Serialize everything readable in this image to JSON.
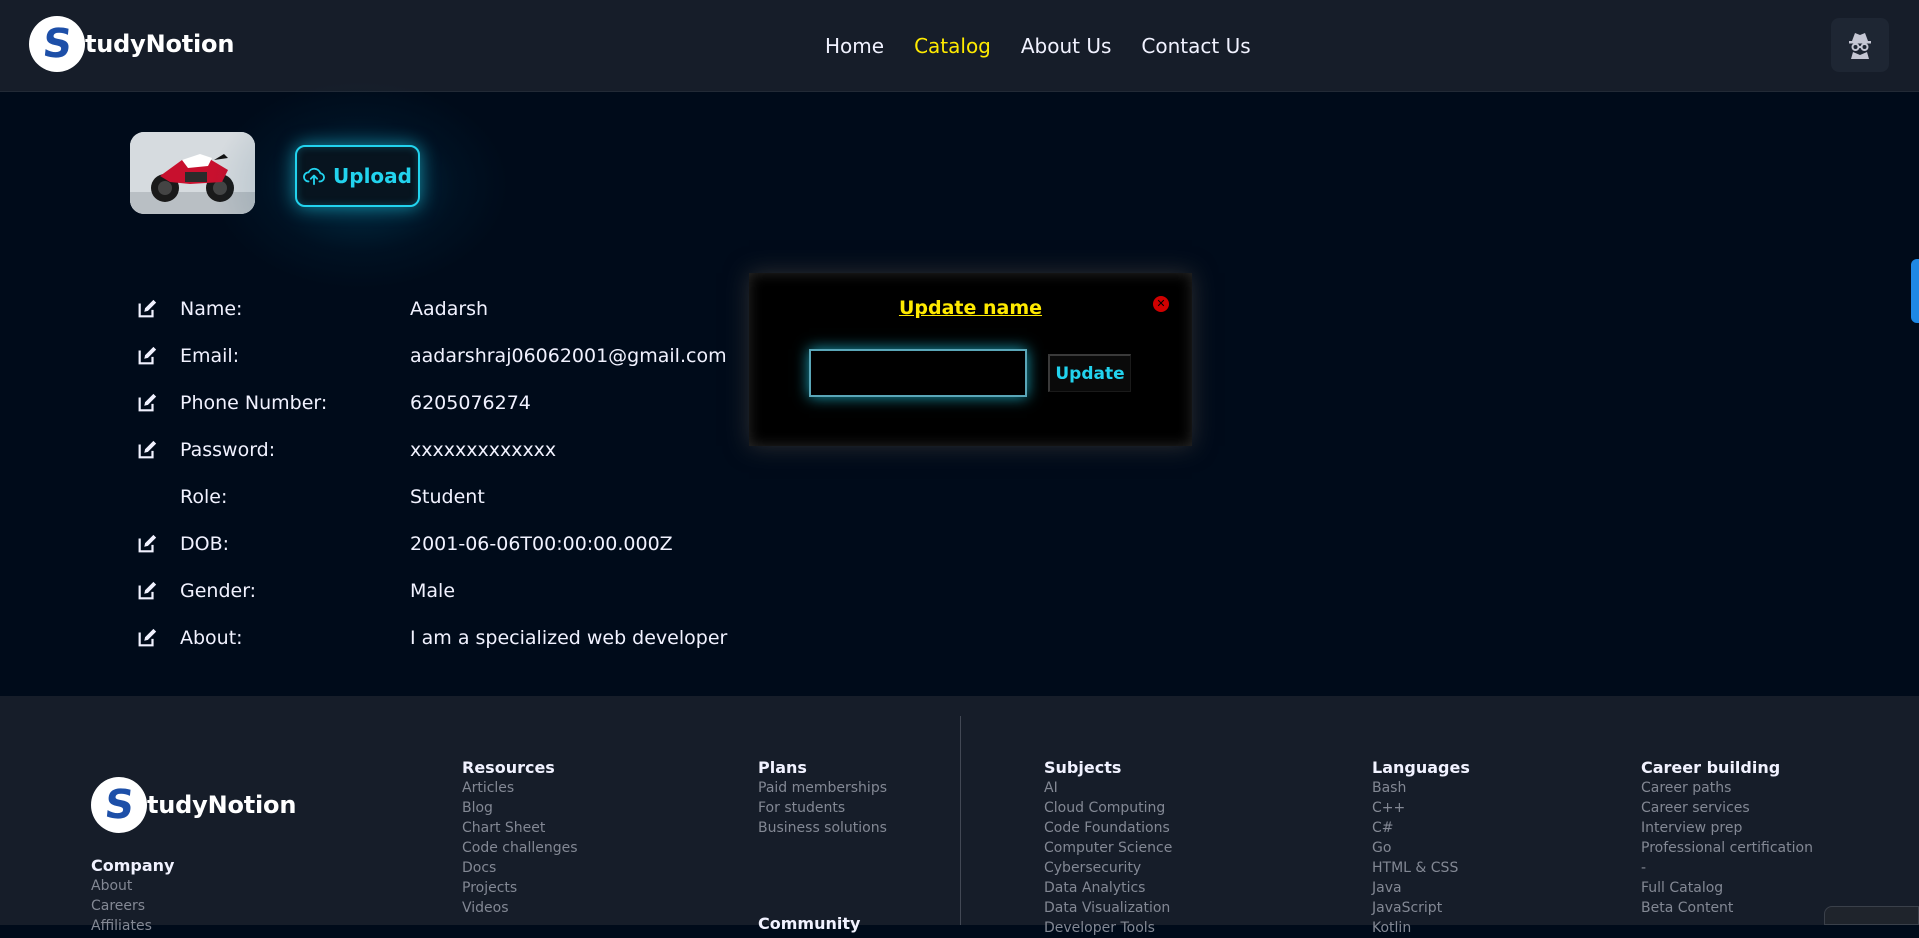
{
  "header": {
    "logo_letter": "S",
    "logo_text": "tudyNotion",
    "nav": [
      {
        "label": "Home",
        "active": false
      },
      {
        "label": "Catalog",
        "active": true
      },
      {
        "label": "About Us",
        "active": false
      },
      {
        "label": "Contact Us",
        "active": false
      }
    ],
    "user_icon": "incognito-user-icon"
  },
  "profile": {
    "upload_label": "Upload",
    "upload_icon": "cloud-upload-icon",
    "fields": [
      {
        "key": "Name:",
        "value": "Aadarsh",
        "editable": true
      },
      {
        "key": "Email:",
        "value": "aadarshraj06062001@gmail.com",
        "editable": true
      },
      {
        "key": "Phone Number:",
        "value": "6205076274",
        "editable": true
      },
      {
        "key": "Password:",
        "value": "xxxxxxxxxxxxx",
        "editable": true
      },
      {
        "key": "Role:",
        "value": "Student",
        "editable": false
      },
      {
        "key": "DOB:",
        "value": "2001-06-06T00:00:00.000Z",
        "editable": true
      },
      {
        "key": "Gender:",
        "value": "Male",
        "editable": true
      },
      {
        "key": "About:",
        "value": "I am a specialized web developer",
        "editable": true
      }
    ]
  },
  "modal": {
    "title": "Update name",
    "input_value": "",
    "update_label": "Update",
    "close_glyph": "✕"
  },
  "footer": {
    "logo_letter": "S",
    "logo_text": "tudyNotion",
    "company": {
      "heading": "Company",
      "items": [
        "About",
        "Careers",
        "Affiliates"
      ]
    },
    "resources": {
      "heading": "Resources",
      "items": [
        "Articles",
        "Blog",
        "Chart Sheet",
        "Code challenges",
        "Docs",
        "Projects",
        "Videos"
      ]
    },
    "plans": {
      "heading": "Plans",
      "items": [
        "Paid memberships",
        "For students",
        "Business solutions"
      ]
    },
    "community": {
      "heading": "Community"
    },
    "subjects": {
      "heading": "Subjects",
      "items": [
        "AI",
        "Cloud Computing",
        "Code Foundations",
        "Computer Science",
        "Cybersecurity",
        "Data Analytics",
        "Data Visualization",
        "Developer Tools"
      ]
    },
    "languages": {
      "heading": "Languages",
      "items": [
        "Bash",
        "C++",
        "C#",
        "Go",
        "HTML & CSS",
        "Java",
        "JavaScript",
        "Kotlin"
      ]
    },
    "career": {
      "heading": "Career building",
      "items": [
        "Career paths",
        "Career services",
        "Interview prep",
        "Professional certification",
        "-",
        "Full Catalog",
        "Beta Content"
      ]
    }
  },
  "colors": {
    "accent_yellow": "#ffea00",
    "accent_cyan": "#22d3ee",
    "bg": "#000b1a",
    "header_bg": "#161d29"
  }
}
